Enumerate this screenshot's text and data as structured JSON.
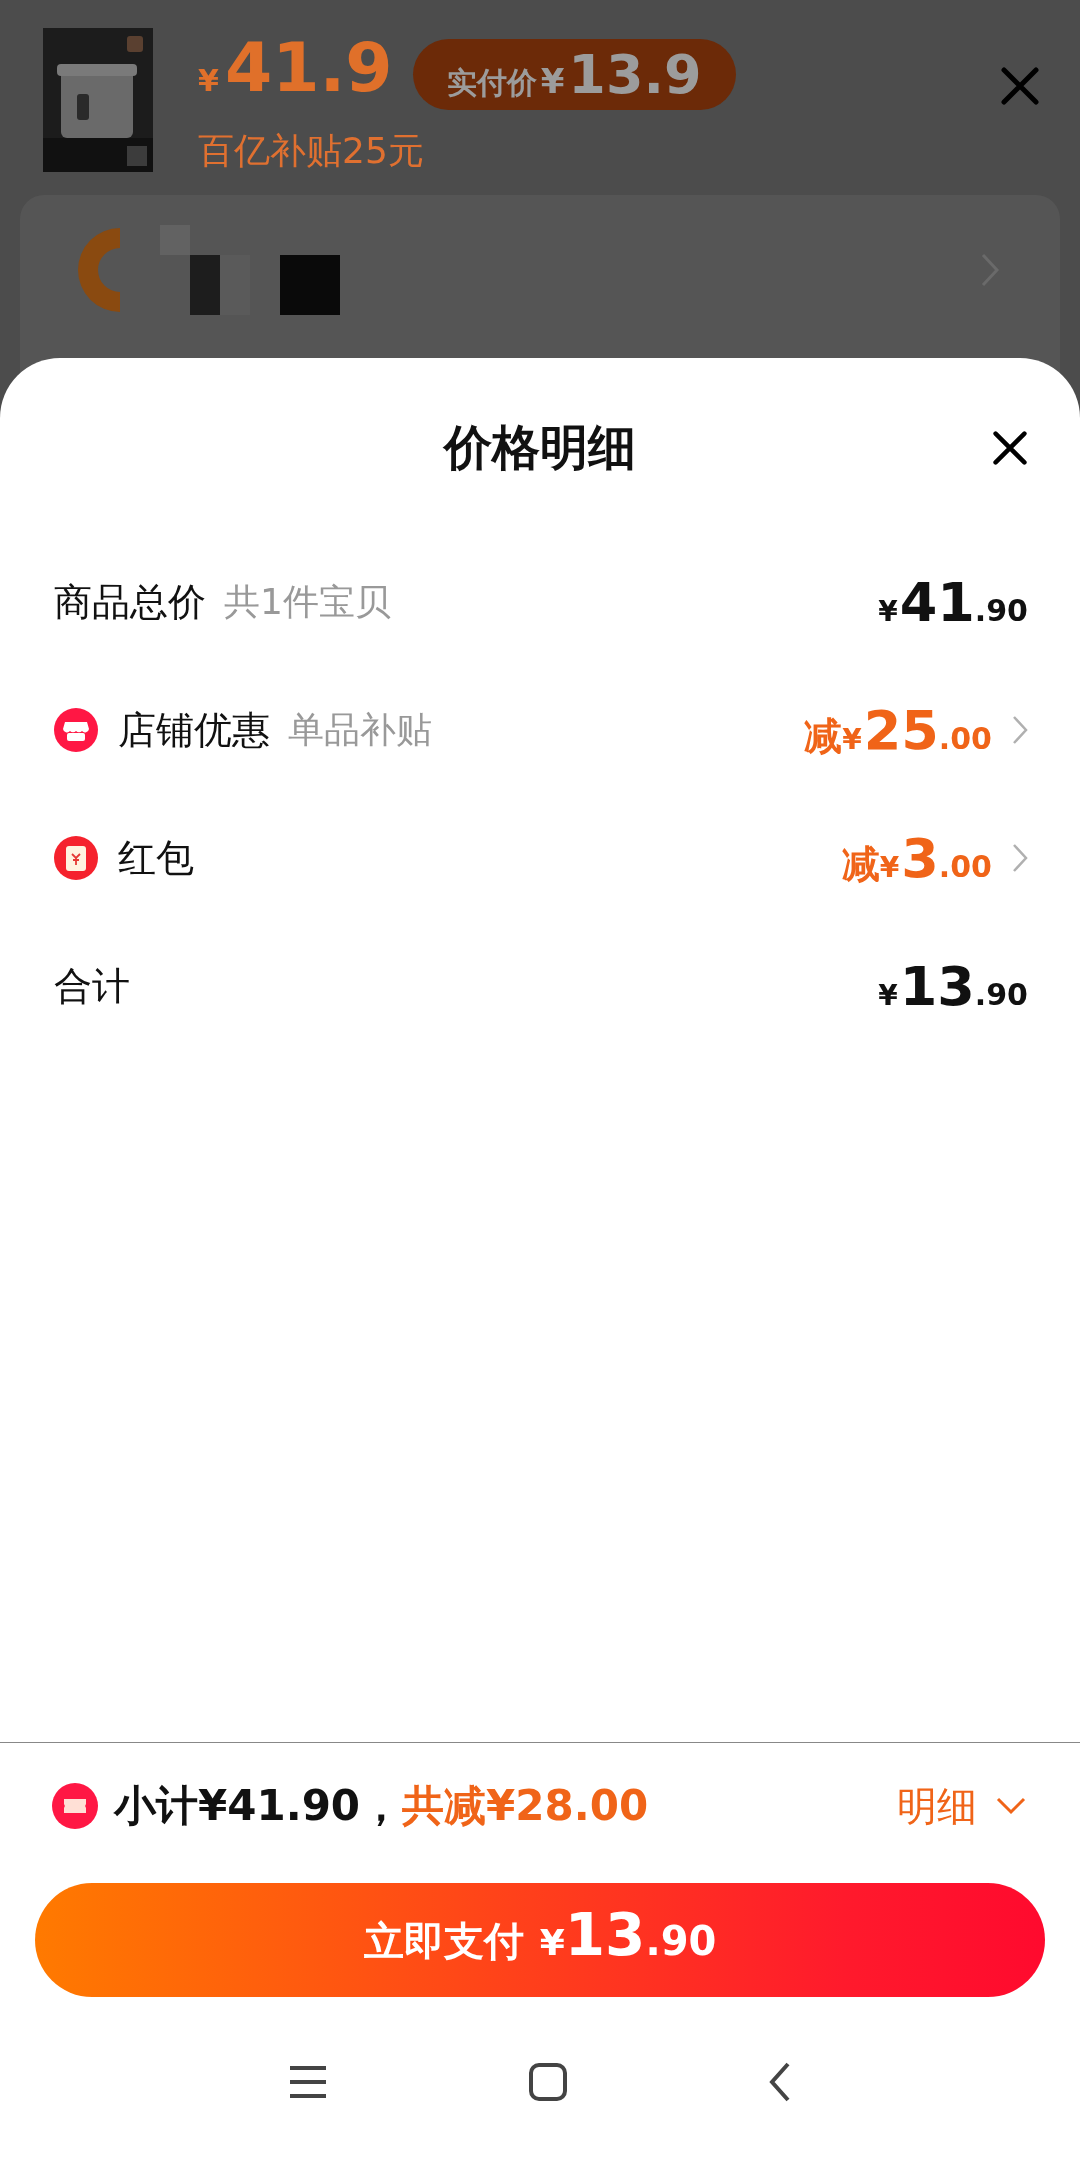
{
  "product": {
    "price": {
      "currency": "¥",
      "amount": "41.9"
    },
    "badge": {
      "label": "实付价",
      "currency": "¥",
      "amount": "13.9"
    },
    "subsidy": "百亿补贴25元"
  },
  "sheet": {
    "title": "价格明细",
    "rows": [
      {
        "kind": "plain",
        "label": "商品总价",
        "note": "共1件宝贝",
        "price": {
          "currency": "¥",
          "integer": "41",
          "decimal": ".90"
        },
        "discount": false,
        "chevron": false
      },
      {
        "kind": "shop",
        "label": "店铺优惠",
        "note": "单品补贴",
        "price": {
          "prefix": "减",
          "currency": "¥",
          "integer": "25",
          "decimal": ".00"
        },
        "discount": true,
        "chevron": true
      },
      {
        "kind": "redpacket",
        "label": "红包",
        "price": {
          "prefix": "减",
          "currency": "¥",
          "integer": "3",
          "decimal": ".00"
        },
        "discount": true,
        "chevron": true
      },
      {
        "kind": "plain",
        "label": "合计",
        "price": {
          "currency": "¥",
          "integer": "13",
          "decimal": ".90"
        },
        "discount": false,
        "chevron": false
      }
    ]
  },
  "footer": {
    "subtotal": "小计¥41.90，",
    "saving": "共减¥28.00",
    "detail_link": "明细",
    "expanded": false,
    "pay_button": {
      "label": "立即支付",
      "currency": "¥",
      "integer": "13",
      "decimal": ".90"
    }
  }
}
